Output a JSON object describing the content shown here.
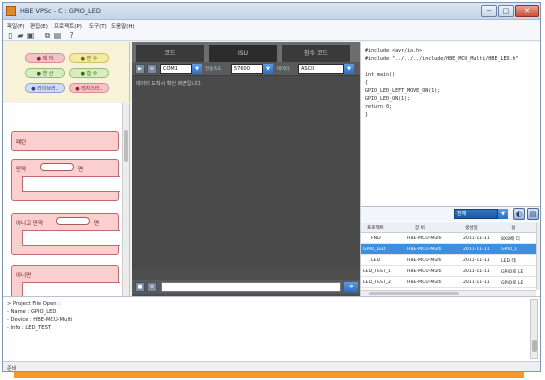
{
  "window": {
    "title": "HBE VPSc - C : GPIO_LED",
    "buttons": [
      "−",
      "□",
      "✕"
    ]
  },
  "menu": [
    "파일(F)",
    "편집(E)",
    "프로젝트(P)",
    "도구(T)",
    "도움말(H)"
  ],
  "toolbar_icons": [
    "new-file-icon",
    "open-folder-icon",
    "save-icon",
    "copy-icon",
    "paste-icon",
    "help-icon"
  ],
  "toolbar_glyphs": [
    "▯",
    "▰",
    "▣",
    "⧉",
    "▤",
    "?"
  ],
  "palette": {
    "categories": [
      {
        "label": "● 제 어",
        "color": "pink"
      },
      {
        "label": "● 변 수",
        "color": "yellow"
      },
      {
        "label": "● 연 산",
        "color": "green"
      },
      {
        "label": "● 함 수",
        "color": "green"
      },
      {
        "label": "● 라이브러..",
        "color": "blue"
      },
      {
        "label": "● 레지스터..",
        "color": "pink"
      }
    ]
  },
  "blocks": {
    "items": [
      {
        "text": "패턴"
      },
      {
        "text_before": "만약",
        "text_after": "면"
      },
      {
        "text_before": "아니고 만약",
        "text_after": "면"
      },
      {
        "text": "아니면"
      }
    ]
  },
  "serial": {
    "tabs": [
      "코드",
      "ISU",
      "함수 코드"
    ],
    "port_value": "COM1",
    "baud_label": "전송속도",
    "baud_value": "57600",
    "display_label": "데이터",
    "display_value": "ASCII",
    "message": "데이터 도착시 확인 화면입니다."
  },
  "code": {
    "lines": [
      "#include <avr/io.h>",
      "#include \"../../../include/HBE_MCU_Multi/HBE_LED.h\"",
      "",
      "int main()",
      "{",
      "    GPIO_LED_LEFT_MOVE_ON(1);",
      "    GPIO_LED_ON(1);",
      "    return 0;",
      "}"
    ]
  },
  "project": {
    "combo_value": "전체",
    "columns": [
      "프로젝트",
      "장 비",
      "생성일",
      "설 "
    ],
    "rows": [
      [
        "FND",
        "HBE-MCU-Multi",
        "2011-11-11",
        "8X8배 디"
      ],
      [
        "GPIO_LED",
        "HBE-MCU-Multi",
        "2011-11-11",
        "GPIO_L"
      ],
      [
        "LED",
        "HBE-MCU-Multi",
        "2011-11-11",
        "LED 테"
      ],
      [
        "LED_TEST_1",
        "HBE-MCU-Multi",
        "2011-11-11",
        "GPIO로 LE"
      ],
      [
        "LED_TEST_2",
        "HBE-MCU-Multi",
        "2011-11-11",
        "GPIO로 LE"
      ]
    ],
    "selected_row": 1
  },
  "output": {
    "lines": [
      "> Project File Open :",
      "  - Name : GPIO_LED",
      "  - Device : HBE-MCU-Multi",
      "  - Info : LED_TEST"
    ]
  },
  "status": {
    "text": "준비"
  }
}
